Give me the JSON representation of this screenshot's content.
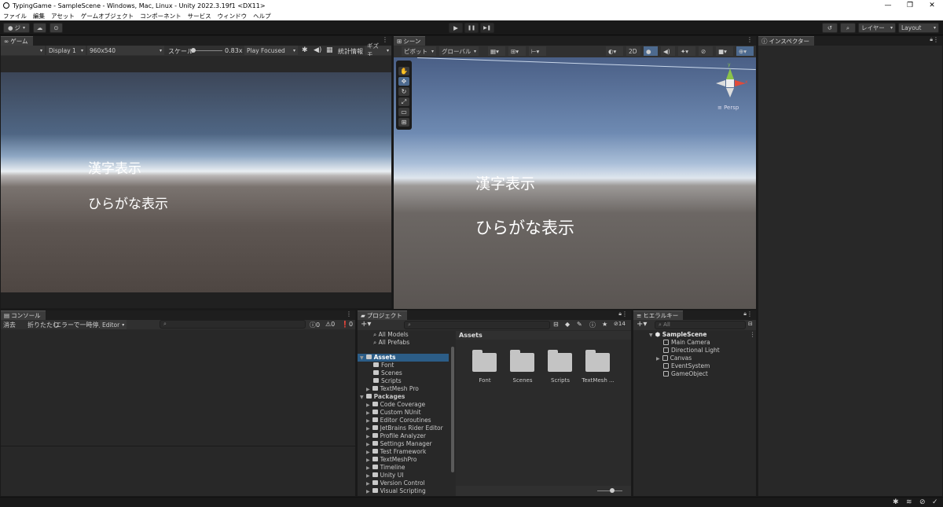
{
  "window": {
    "title": "TypingGame - SampleScene - Windows, Mac, Linux - Unity 2022.3.19f1 <DX11>",
    "minimize": "—",
    "restore": "❐",
    "close": "✕"
  },
  "menu": [
    "ファイル",
    "編集",
    "アセット",
    "ゲームオブジェクト",
    "コンポーネント",
    "サービス",
    "ウィンドウ",
    "ヘルプ"
  ],
  "toolbar": {
    "account_label": "ジ",
    "play": "▶",
    "pause": "❚❚",
    "step": "▶❚",
    "layers_label": "レイヤー",
    "layout_label": "Layout"
  },
  "game_view": {
    "tab_label": "ゲーム",
    "display": "Display 1",
    "resolution": "960x540",
    "scale_label": "スケール",
    "scale_value": "0.83x",
    "play_mode": "Play Focused",
    "stats_label": "統計情報",
    "gizmos_label": "ギズモ",
    "text_kanji": "漢字表示",
    "text_hiragana": "ひらがな表示"
  },
  "scene_view": {
    "tab_label": "シーン",
    "pivot_label": "ピボット",
    "global_label": "グローバル",
    "mode_2d": "2D",
    "persp_label": "≡ Persp",
    "gizmo_y": "y",
    "gizmo_x": "x",
    "text_kanji": "漢字表示",
    "text_hiragana": "ひらがな表示"
  },
  "inspector": {
    "tab_label": "インスペクター"
  },
  "console": {
    "tab_label": "コンソール",
    "clear_label": "消去",
    "collapse_label": "折りたたむ",
    "error_pause_label": "エラーで一時停止",
    "editor_label": "Editor",
    "log_count": "0",
    "warn_count": "0",
    "error_count": "0"
  },
  "project": {
    "tab_label": "プロジェクト",
    "hidden_count": "14",
    "favorites": [
      "All Models",
      "All Prefabs"
    ],
    "assets_root": "Assets",
    "assets_children": [
      "Font",
      "Scenes",
      "Scripts",
      "TextMesh Pro"
    ],
    "packages_root": "Packages",
    "packages_children": [
      "Code Coverage",
      "Custom NUnit",
      "Editor Coroutines",
      "JetBrains Rider Editor",
      "Profile Analyzer",
      "Settings Manager",
      "Test Framework",
      "TextMeshPro",
      "Timeline",
      "Unity UI",
      "Version Control",
      "Visual Scripting"
    ],
    "breadcrumb": "Assets",
    "grid_items": [
      "Font",
      "Scenes",
      "Scripts",
      "TextMesh ..."
    ]
  },
  "hierarchy": {
    "tab_label": "ヒエラルキー",
    "search_placeholder": "All",
    "scene_name": "SampleScene",
    "objects": [
      "Main Camera",
      "Directional Light",
      "Canvas",
      "EventSystem",
      "GameObject"
    ]
  }
}
